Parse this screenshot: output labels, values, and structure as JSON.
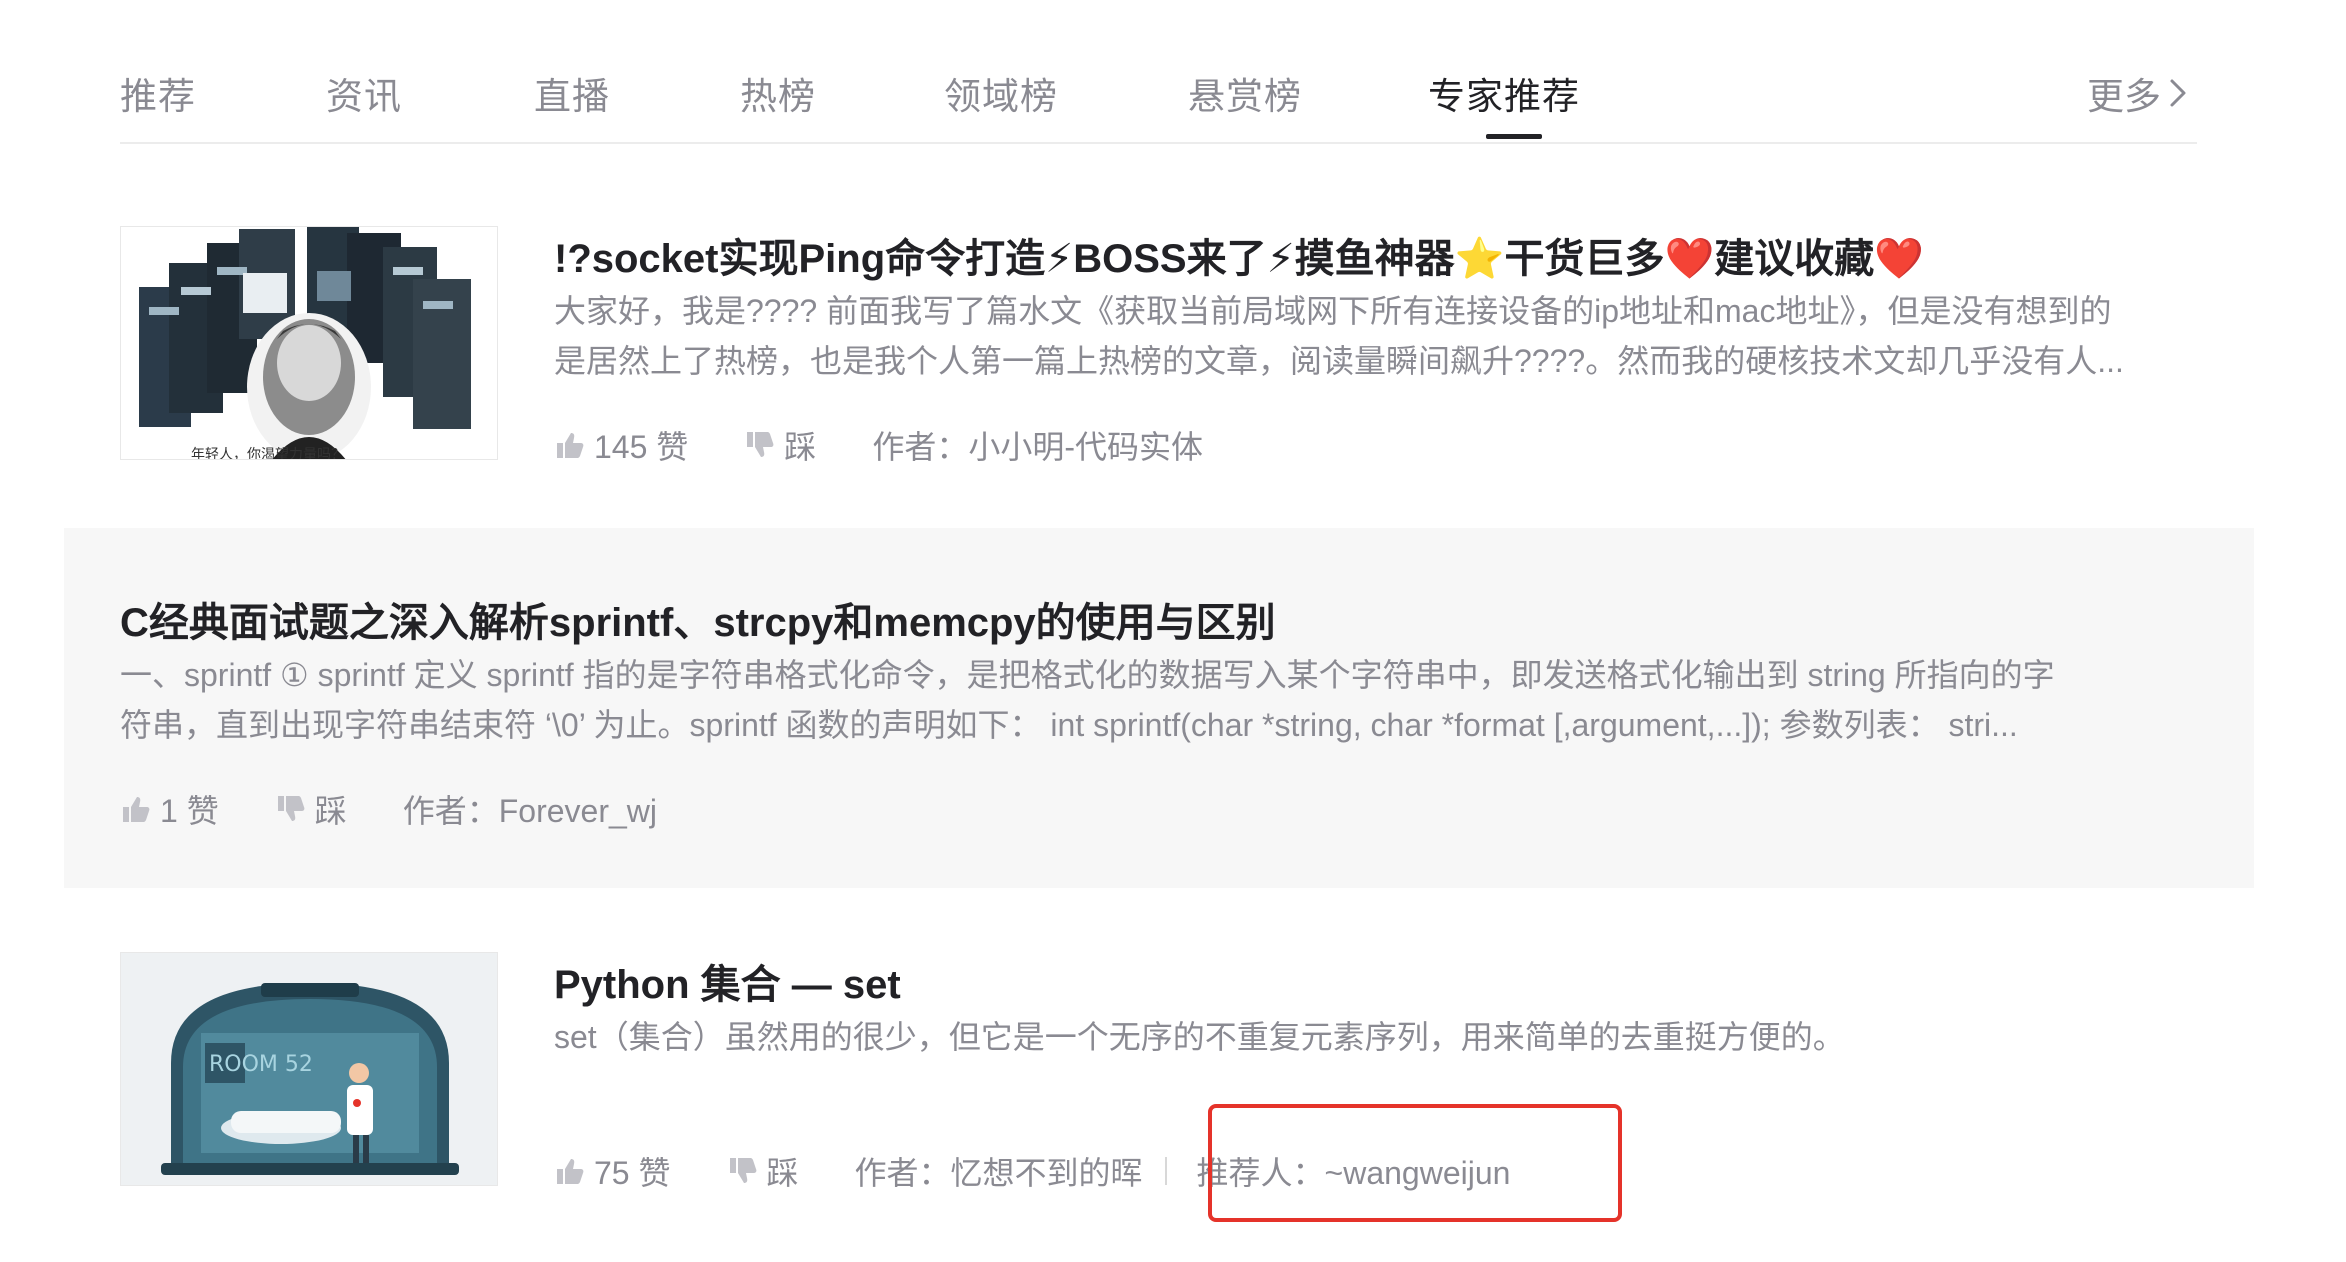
{
  "tabs": [
    {
      "label": "推荐"
    },
    {
      "label": "资讯"
    },
    {
      "label": "直播"
    },
    {
      "label": "热榜"
    },
    {
      "label": "领域榜"
    },
    {
      "label": "悬赏榜"
    },
    {
      "label": "专家推荐",
      "active": true
    }
  ],
  "more_label": "更多",
  "articles": [
    {
      "title": "!?socket实现Ping命令打造⚡BOSS来了⚡摸鱼神器⭐干货巨多❤️建议收藏❤️",
      "desc_line1": "大家好，我是???? 前面我写了篇水文《获取当前局域网下所有连接设备的ip地址和mac地址》，但是没有想到的",
      "desc_line2": "是居然上了热榜，也是我个人第一篇上热榜的文章，阅读量瞬间飙升????。然而我的硬核技术文却几乎没有人...",
      "likes": "145 赞",
      "dislike": "踩",
      "author": "作者：小小明-代码实体",
      "thumb_caption": "年轻人，你渴望力量吗？"
    },
    {
      "title": "C经典面试题之深入解析sprintf、strcpy和memcpy的使用与区别",
      "desc_line1": "一、sprintf ① sprintf 定义 sprintf 指的是字符串格式化命令，是把格式化的数据写入某个字符串中，即发送格式化输出到 string 所指向的字",
      "desc_line2": "符串，直到出现字符串结束符 ‘\\0’ 为止。sprintf 函数的声明如下： int sprintf(char *string, char *format [,argument,...]); 参数列表： stri...",
      "likes": "1 赞",
      "dislike": "踩",
      "author": "作者：Forever_wj"
    },
    {
      "title": "Python 集合 — set",
      "desc_line1": "set（集合）虽然用的很少，但它是一个无序的不重复元素序列，用来简单的去重挺方便的。",
      "likes": "75 赞",
      "dislike": "踩",
      "author": "作者：忆想不到的晖",
      "recommender": "推荐人：~wangweijun",
      "thumb_caption": "ROOM 52"
    }
  ],
  "colors": {
    "text_primary": "#222226",
    "text_secondary": "#8a8a92",
    "highlight_box": "#e5332a",
    "card_bg": "#f7f7f7"
  }
}
